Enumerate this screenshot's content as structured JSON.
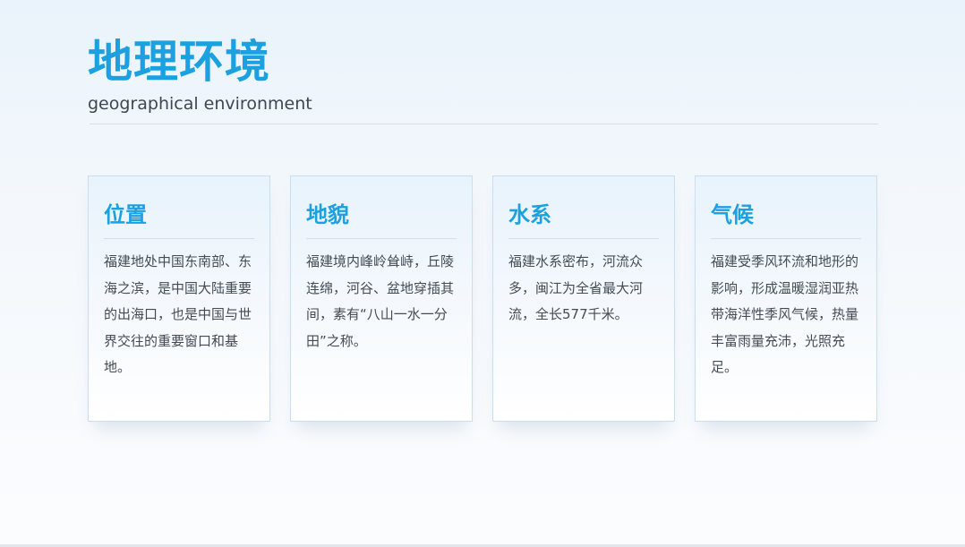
{
  "slide": {
    "title": "地理环境",
    "subtitle": "geographical environment"
  },
  "cards": [
    {
      "title": "位置",
      "text": "福建地处中国东南部、东海之滨，是中国大陆重要的出海口，也是中国与世界交往的重要窗口和基地。"
    },
    {
      "title": "地貌",
      "text": "福建境内峰岭耸峙，丘陵连绵，河谷、盆地穿插其间，素有“八山一水一分田”之称。"
    },
    {
      "title": "水系",
      "text": "福建水系密布，河流众多，闽江为全省最大河流，全长577千米。"
    },
    {
      "title": "气候",
      "text": "福建受季风环流和地形的影响，形成温暖湿润亚热带海洋性季风气候，热量丰富雨量充沛，光照充足。"
    }
  ],
  "colors": {
    "accent": "#1ba0e0",
    "body_text": "#444b54",
    "card_border": "#c9def0"
  }
}
